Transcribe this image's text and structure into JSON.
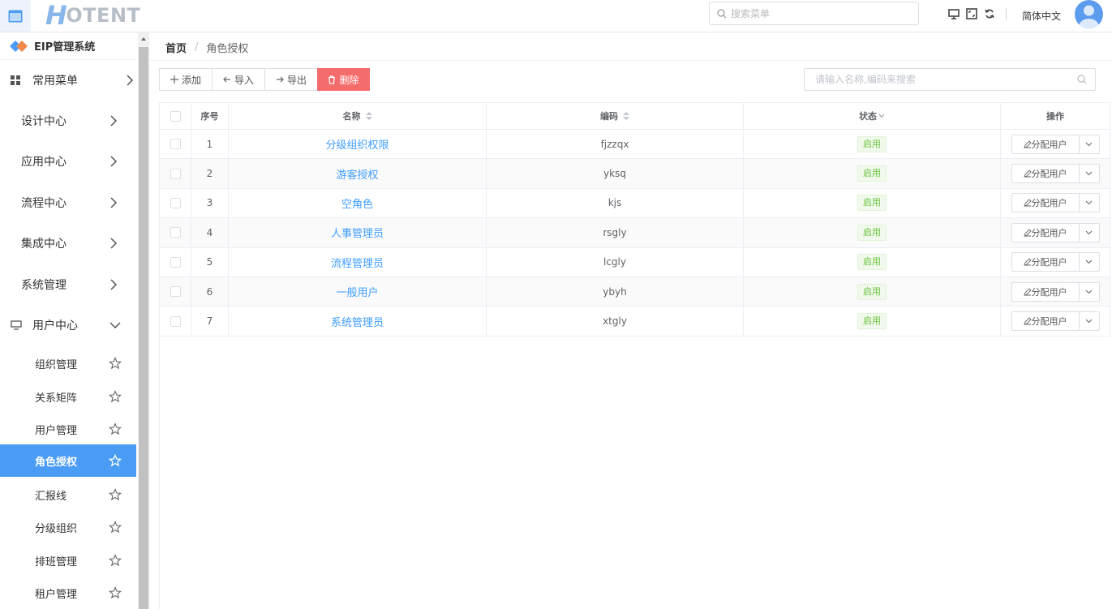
{
  "header": {
    "logo_letter": "H",
    "logo_text": "OTENT",
    "search_placeholder": "搜索菜单",
    "language": "简体中文"
  },
  "sidebar": {
    "system_title": "EIP管理系统",
    "menus": [
      {
        "label": "常用菜单",
        "has_icon": true
      },
      {
        "label": "设计中心"
      },
      {
        "label": "应用中心"
      },
      {
        "label": "流程中心"
      },
      {
        "label": "集成中心"
      },
      {
        "label": "系统管理"
      },
      {
        "label": "用户中心",
        "expanded": true
      }
    ],
    "sub_items": [
      {
        "label": "组织管理"
      },
      {
        "label": "关系矩阵"
      },
      {
        "label": "用户管理"
      },
      {
        "label": "角色授权",
        "active": true
      },
      {
        "label": "汇报线"
      },
      {
        "label": "分级组织"
      },
      {
        "label": "排班管理"
      },
      {
        "label": "租户管理"
      }
    ]
  },
  "breadcrumb": {
    "home": "首页",
    "separator": "/",
    "current": "角色授权"
  },
  "toolbar": {
    "add": "添加",
    "import": "导入",
    "export": "导出",
    "delete": "删除"
  },
  "search": {
    "placeholder": "请输入名称,编码来搜索"
  },
  "table": {
    "columns": {
      "index": "序号",
      "name": "名称",
      "code": "编码",
      "status": "状态",
      "operation": "操作"
    },
    "op_label": "分配用户",
    "rows": [
      {
        "index": "1",
        "name": "分级组织权限",
        "code": "fjzzqx",
        "status": "启用"
      },
      {
        "index": "2",
        "name": "游客授权",
        "code": "yksq",
        "status": "启用"
      },
      {
        "index": "3",
        "name": "空角色",
        "code": "kjs",
        "status": "启用"
      },
      {
        "index": "4",
        "name": "人事管理员",
        "code": "rsgly",
        "status": "启用"
      },
      {
        "index": "5",
        "name": "流程管理员",
        "code": "lcgly",
        "status": "启用"
      },
      {
        "index": "6",
        "name": "一般用户",
        "code": "ybyh",
        "status": "启用"
      },
      {
        "index": "7",
        "name": "系统管理员",
        "code": "xtgly",
        "status": "启用"
      }
    ]
  },
  "colors": {
    "primary": "#409eff",
    "active_menu": "#4a9cf5",
    "danger": "#f56c6c",
    "success": "#67c23a"
  }
}
